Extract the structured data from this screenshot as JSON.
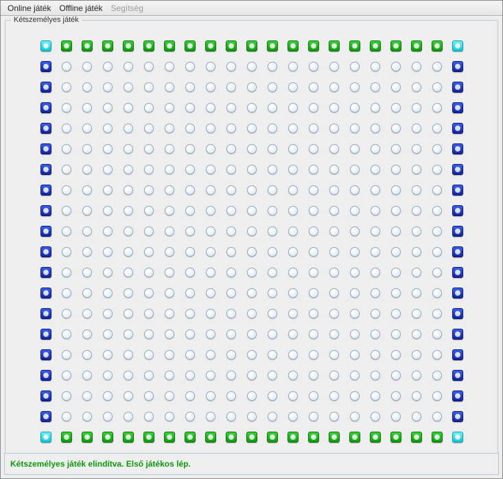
{
  "menubar": {
    "items": [
      {
        "label": "Online játék",
        "enabled": true
      },
      {
        "label": "Offline játék",
        "enabled": true
      },
      {
        "label": "Segítség",
        "enabled": false
      }
    ]
  },
  "panel": {
    "title": "Kétszemélyes játék"
  },
  "status": {
    "text": "Kétszemélyes játék elindítva. Első játékos lép."
  },
  "board": {
    "rows": 20,
    "cols": 21,
    "cells": {
      "corner": "cyan",
      "top_edge": "green",
      "bottom_edge": "green",
      "left_edge": "blue",
      "right_edge": "blue",
      "inner": "empty"
    }
  }
}
